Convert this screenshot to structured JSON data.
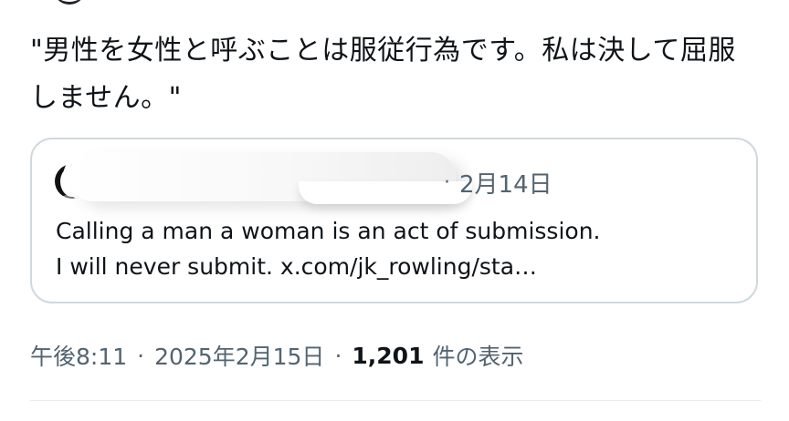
{
  "post": {
    "text": "\"男性を女性と呼ぶことは服従行為です。私は決して屈服しません。\"",
    "timestamp": "午後8:11",
    "date": "2025年2月15日",
    "view_count": "1,201",
    "view_label": "件の表示"
  },
  "quote": {
    "date": "2月14日",
    "text": "Calling a man a woman is an act of submission.\nI will never submit. x.com/jk_rowling/sta…"
  }
}
